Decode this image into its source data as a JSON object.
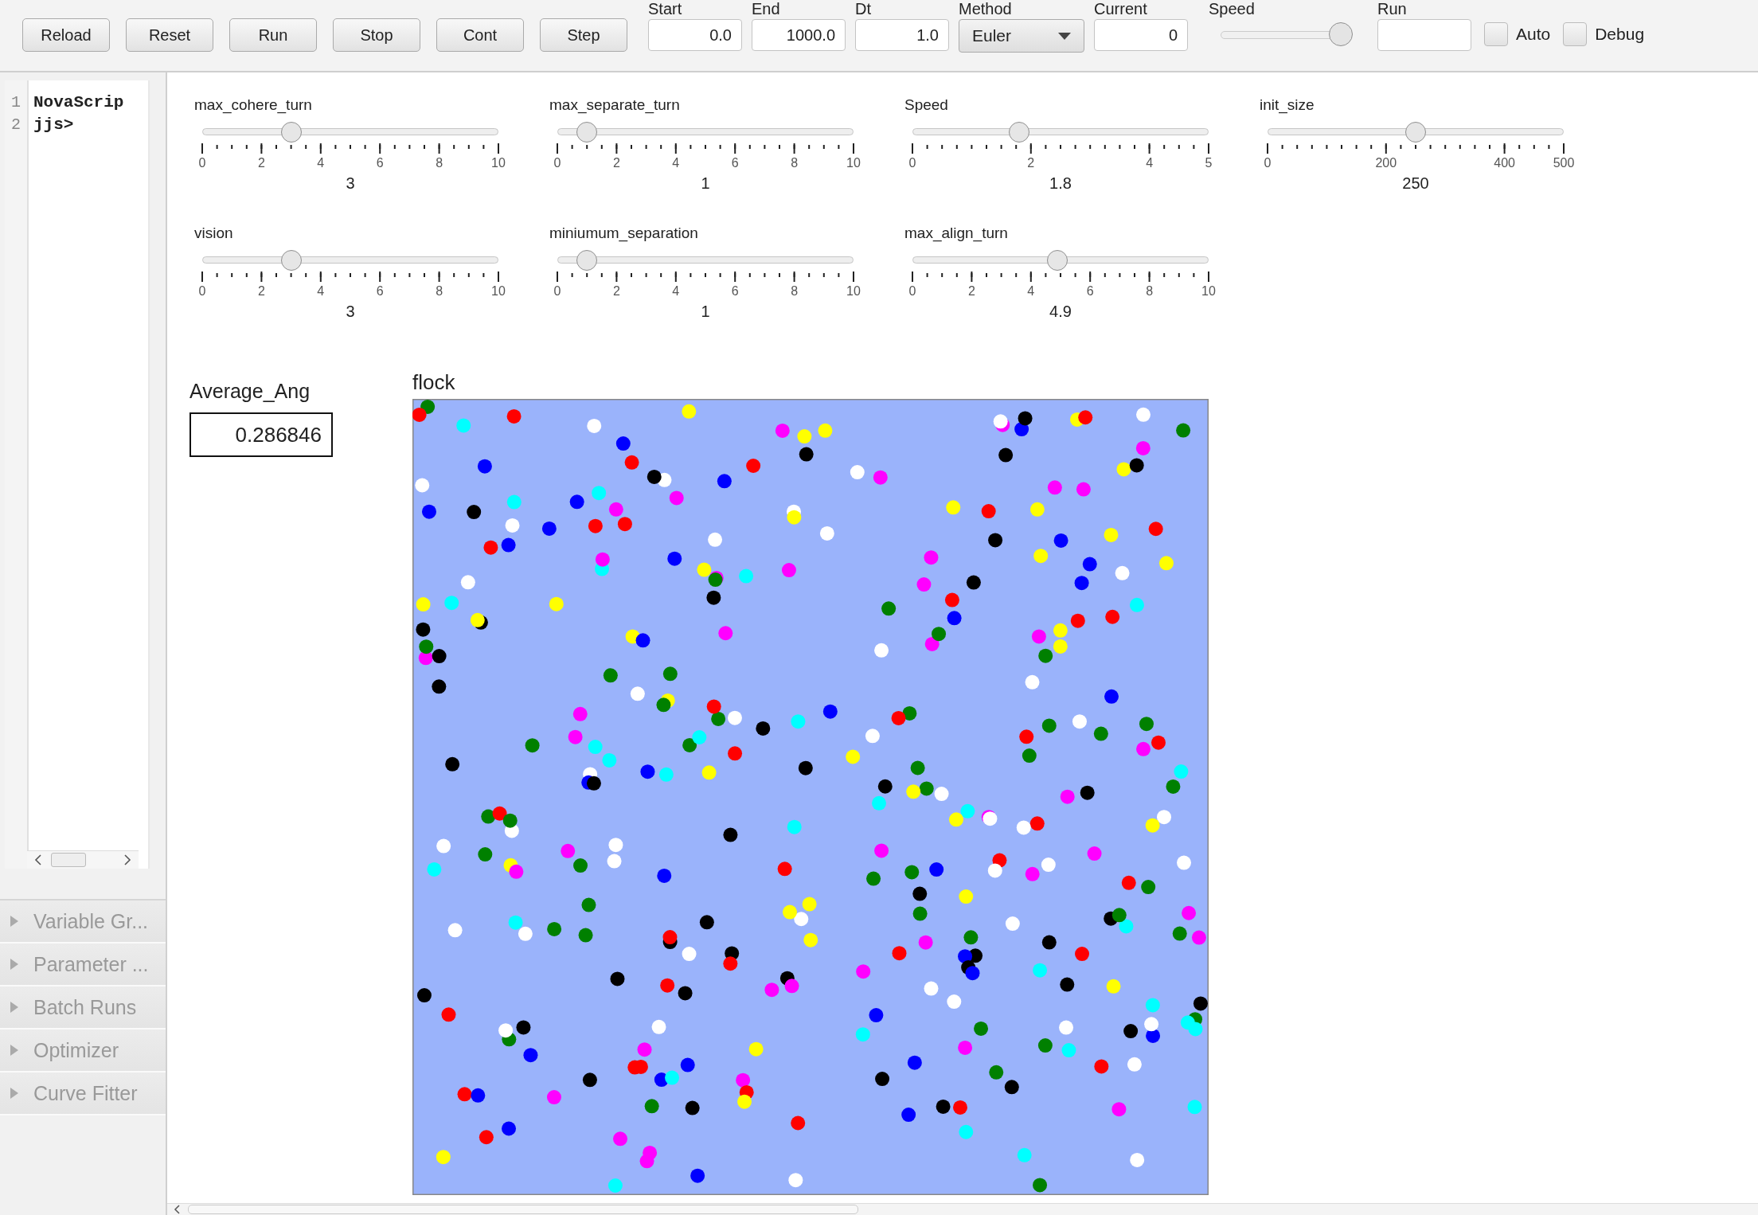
{
  "toolbar": {
    "buttons": [
      "Reload",
      "Reset",
      "Run",
      "Stop",
      "Cont",
      "Step"
    ],
    "fields": [
      {
        "kind": "input",
        "label": "Start",
        "value": "0.0"
      },
      {
        "kind": "input",
        "label": "End",
        "value": "1000.0"
      },
      {
        "kind": "input",
        "label": "Dt",
        "value": "1.0"
      },
      {
        "kind": "dropdown",
        "label": "Method",
        "value": "Euler"
      },
      {
        "kind": "input",
        "label": "Current",
        "value": "0"
      },
      {
        "kind": "slider",
        "label": "Speed",
        "level": 0.9
      },
      {
        "kind": "input",
        "label": "Run"
      }
    ],
    "checkboxes": [
      {
        "label": "Auto",
        "checked": false
      },
      {
        "label": "Debug",
        "checked": false
      }
    ]
  },
  "editor": {
    "lines": [
      {
        "number": "1",
        "text": "NovaScrip"
      },
      {
        "number": "2",
        "text": "jjs>"
      }
    ]
  },
  "side_panels": [
    "Variable Gr...",
    "Parameter ...",
    "Batch Runs",
    "Optimizer",
    "Curve Fitter"
  ],
  "sliders": [
    {
      "label": "max_cohere_turn",
      "level": 0.3,
      "ticks": [
        "0",
        "2",
        "4",
        "6",
        "8",
        "10"
      ],
      "value": "3"
    },
    {
      "label": "max_separate_turn",
      "level": 0.1,
      "ticks": [
        "0",
        "2",
        "4",
        "6",
        "8",
        "10"
      ],
      "value": "1"
    },
    {
      "label": "Speed",
      "level": 0.36,
      "ticks": [
        "0",
        "2",
        "4",
        "5"
      ],
      "value": "1.8"
    },
    {
      "label": "init_size",
      "level": 0.5,
      "ticks": [
        "0",
        "200",
        "400",
        "500"
      ],
      "value": "250"
    },
    {
      "label": "vision",
      "level": 0.3,
      "ticks": [
        "0",
        "2",
        "4",
        "6",
        "8",
        "10"
      ],
      "value": "3"
    },
    {
      "label": "miniumum_separation",
      "level": 0.1,
      "ticks": [
        "0",
        "2",
        "4",
        "6",
        "8",
        "10"
      ],
      "value": "1"
    },
    {
      "label": "max_align_turn",
      "level": 0.49,
      "ticks": [
        "0",
        "2",
        "4",
        "6",
        "8",
        "10"
      ],
      "value": "4.9"
    }
  ],
  "output": {
    "label": "Average_Ang",
    "value": "0.286846"
  },
  "canvas": {
    "title": "flock"
  }
}
